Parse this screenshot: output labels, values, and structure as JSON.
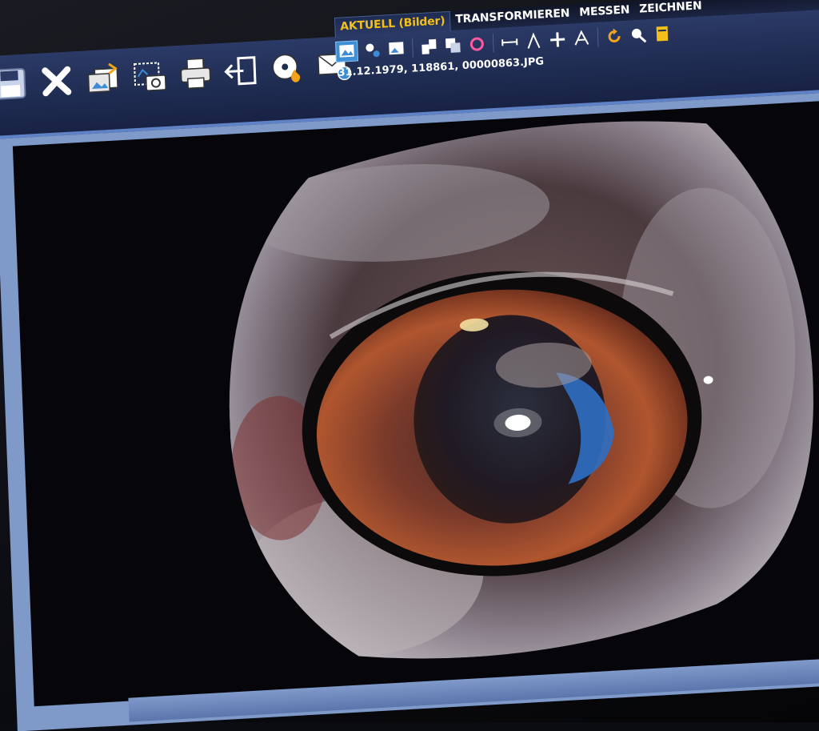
{
  "tabs": [
    {
      "label": "AKTUELL (Bilder)",
      "active": true
    },
    {
      "label": "TRANSFORMIEREN",
      "active": false
    },
    {
      "label": "MESSEN",
      "active": false
    },
    {
      "label": "ZEICHNEN",
      "active": false
    }
  ],
  "toolbar": {
    "big_icons": [
      "save-icon",
      "close-icon",
      "import-images-icon",
      "capture-photo-icon",
      "print-icon",
      "export-icon",
      "burn-disc-icon",
      "send-email-icon"
    ],
    "small_icons": [
      "image-view-icon",
      "adjust-brightness-icon",
      "image-icon",
      "compare-icon",
      "duplicate-icon",
      "rotate-icon",
      "measure-line-icon",
      "measure-angle-icon",
      "cross-icon",
      "split-icon",
      "refresh-icon",
      "search-icon",
      "document-icon"
    ]
  },
  "image_info": {
    "filename_line": "31.12.1979, 118861, 00000863.JPG"
  },
  "colors": {
    "toolbar_bg": "#1f2c52",
    "active_tab_text": "#f2c019",
    "accent_blue": "#3d8fd6",
    "viewer_bg": "#05050a"
  }
}
